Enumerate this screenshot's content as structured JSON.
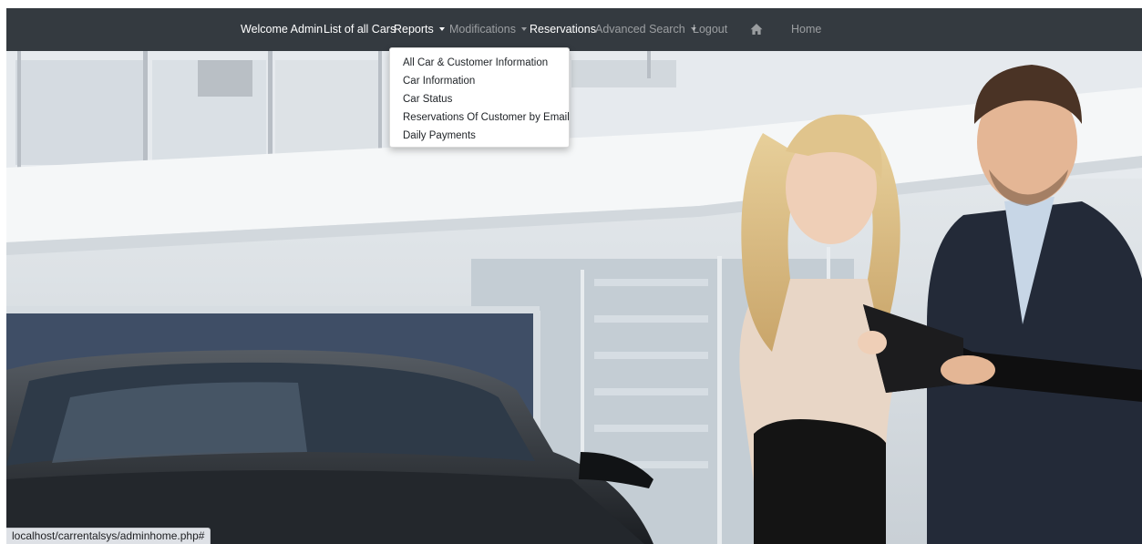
{
  "navbar": {
    "welcome": "Welcome Admin",
    "list_all_cars": "List of all Cars",
    "reports": "Reports",
    "modifications": "Modifications",
    "reservations": "Reservations",
    "advanced_search": "Advanced Search",
    "logout": "Logout",
    "home_icon": "home-icon",
    "home": "Home",
    "background_color": "#343a40"
  },
  "reports_dropdown": {
    "items": [
      "All Car & Customer Information",
      "Car Information",
      "Car Status",
      "Reservations Of Customer by Email",
      "Daily Payments"
    ]
  },
  "status_bar": {
    "url": "localhost/carrentalsys/adminhome.php#"
  }
}
